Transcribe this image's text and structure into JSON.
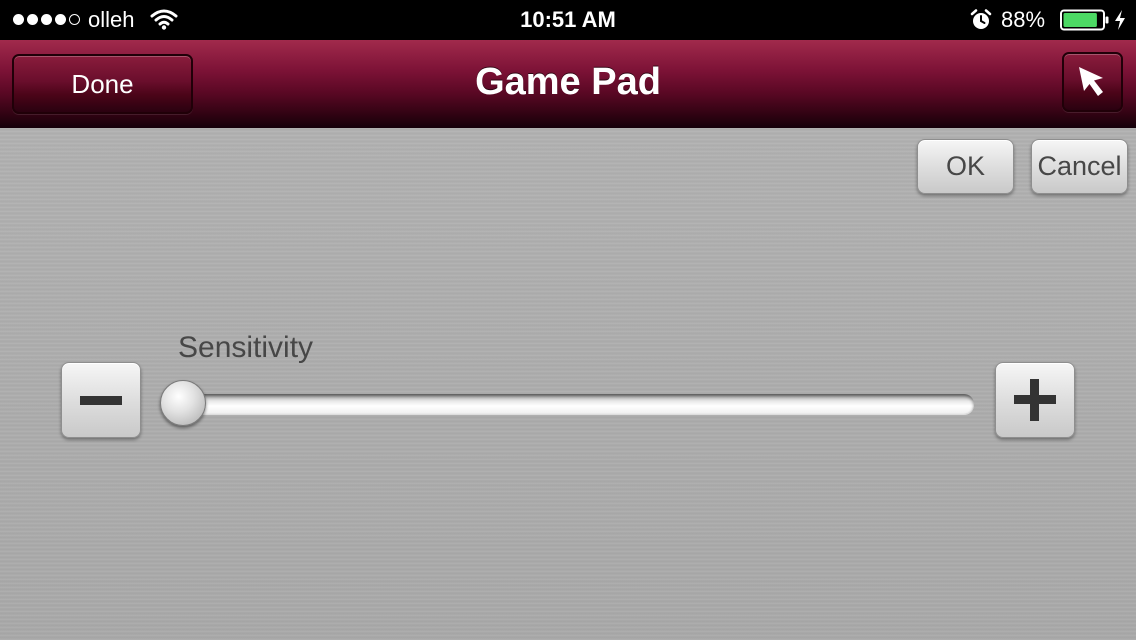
{
  "status_bar": {
    "signal_filled_dots": 4,
    "signal_total_dots": 5,
    "carrier": "olleh",
    "time": "10:51 AM",
    "battery_percent": "88%",
    "battery_level": 0.88,
    "icons": [
      "wifi-icon",
      "alarm-icon",
      "battery-icon",
      "charging-bolt-icon"
    ]
  },
  "nav": {
    "title": "Game Pad",
    "done_label": "Done",
    "cursor_icon": "cursor-arrow-icon"
  },
  "actions": {
    "ok_label": "OK",
    "cancel_label": "Cancel"
  },
  "sensitivity": {
    "label": "Sensitivity",
    "value_fraction": 0.0,
    "decrease_icon": "minus-icon",
    "increase_icon": "plus-icon"
  },
  "colors": {
    "nav_accent": "#7c1236",
    "battery_green": "#4cd964",
    "content_gray": "#adadad"
  }
}
